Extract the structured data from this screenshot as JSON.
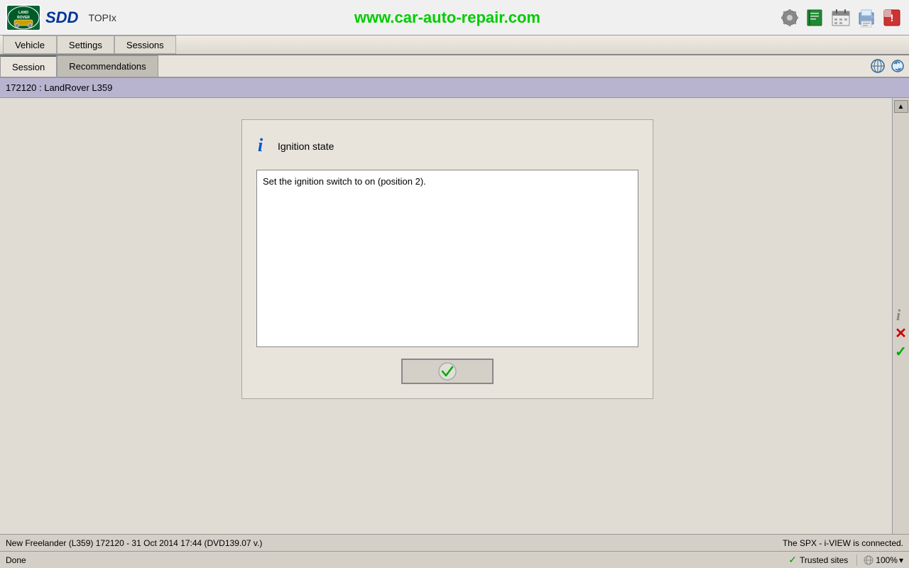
{
  "app": {
    "title": "SDD"
  },
  "header": {
    "logo_text": "LAND\nROVER",
    "sdd_label": "SDD",
    "topix_label": "TOPIx",
    "website": "www.car-auto-repair.com"
  },
  "topnav": {
    "vehicle_label": "Vehicle",
    "settings_label": "Settings",
    "sessions_label": "Sessions"
  },
  "tabs": {
    "session_label": "Session",
    "recommendations_label": "Recommendations"
  },
  "session": {
    "breadcrumb": "172120 : LandRover L359"
  },
  "dialog": {
    "icon": "i",
    "title": "Ignition state",
    "content": "Set the ignition switch to on (position 2).",
    "confirm_icon": "✓"
  },
  "statusbar": {
    "text": "New Freelander (L359) 172120 - 31 Oct 2014 17:44 (DVD139.07 v.)",
    "right_text": "The SPX - i-VIEW is connected."
  },
  "browserbar": {
    "done_label": "Done",
    "trusted_sites_label": "Trusted sites",
    "zoom_label": "100%",
    "zoom_suffix": "▾"
  }
}
